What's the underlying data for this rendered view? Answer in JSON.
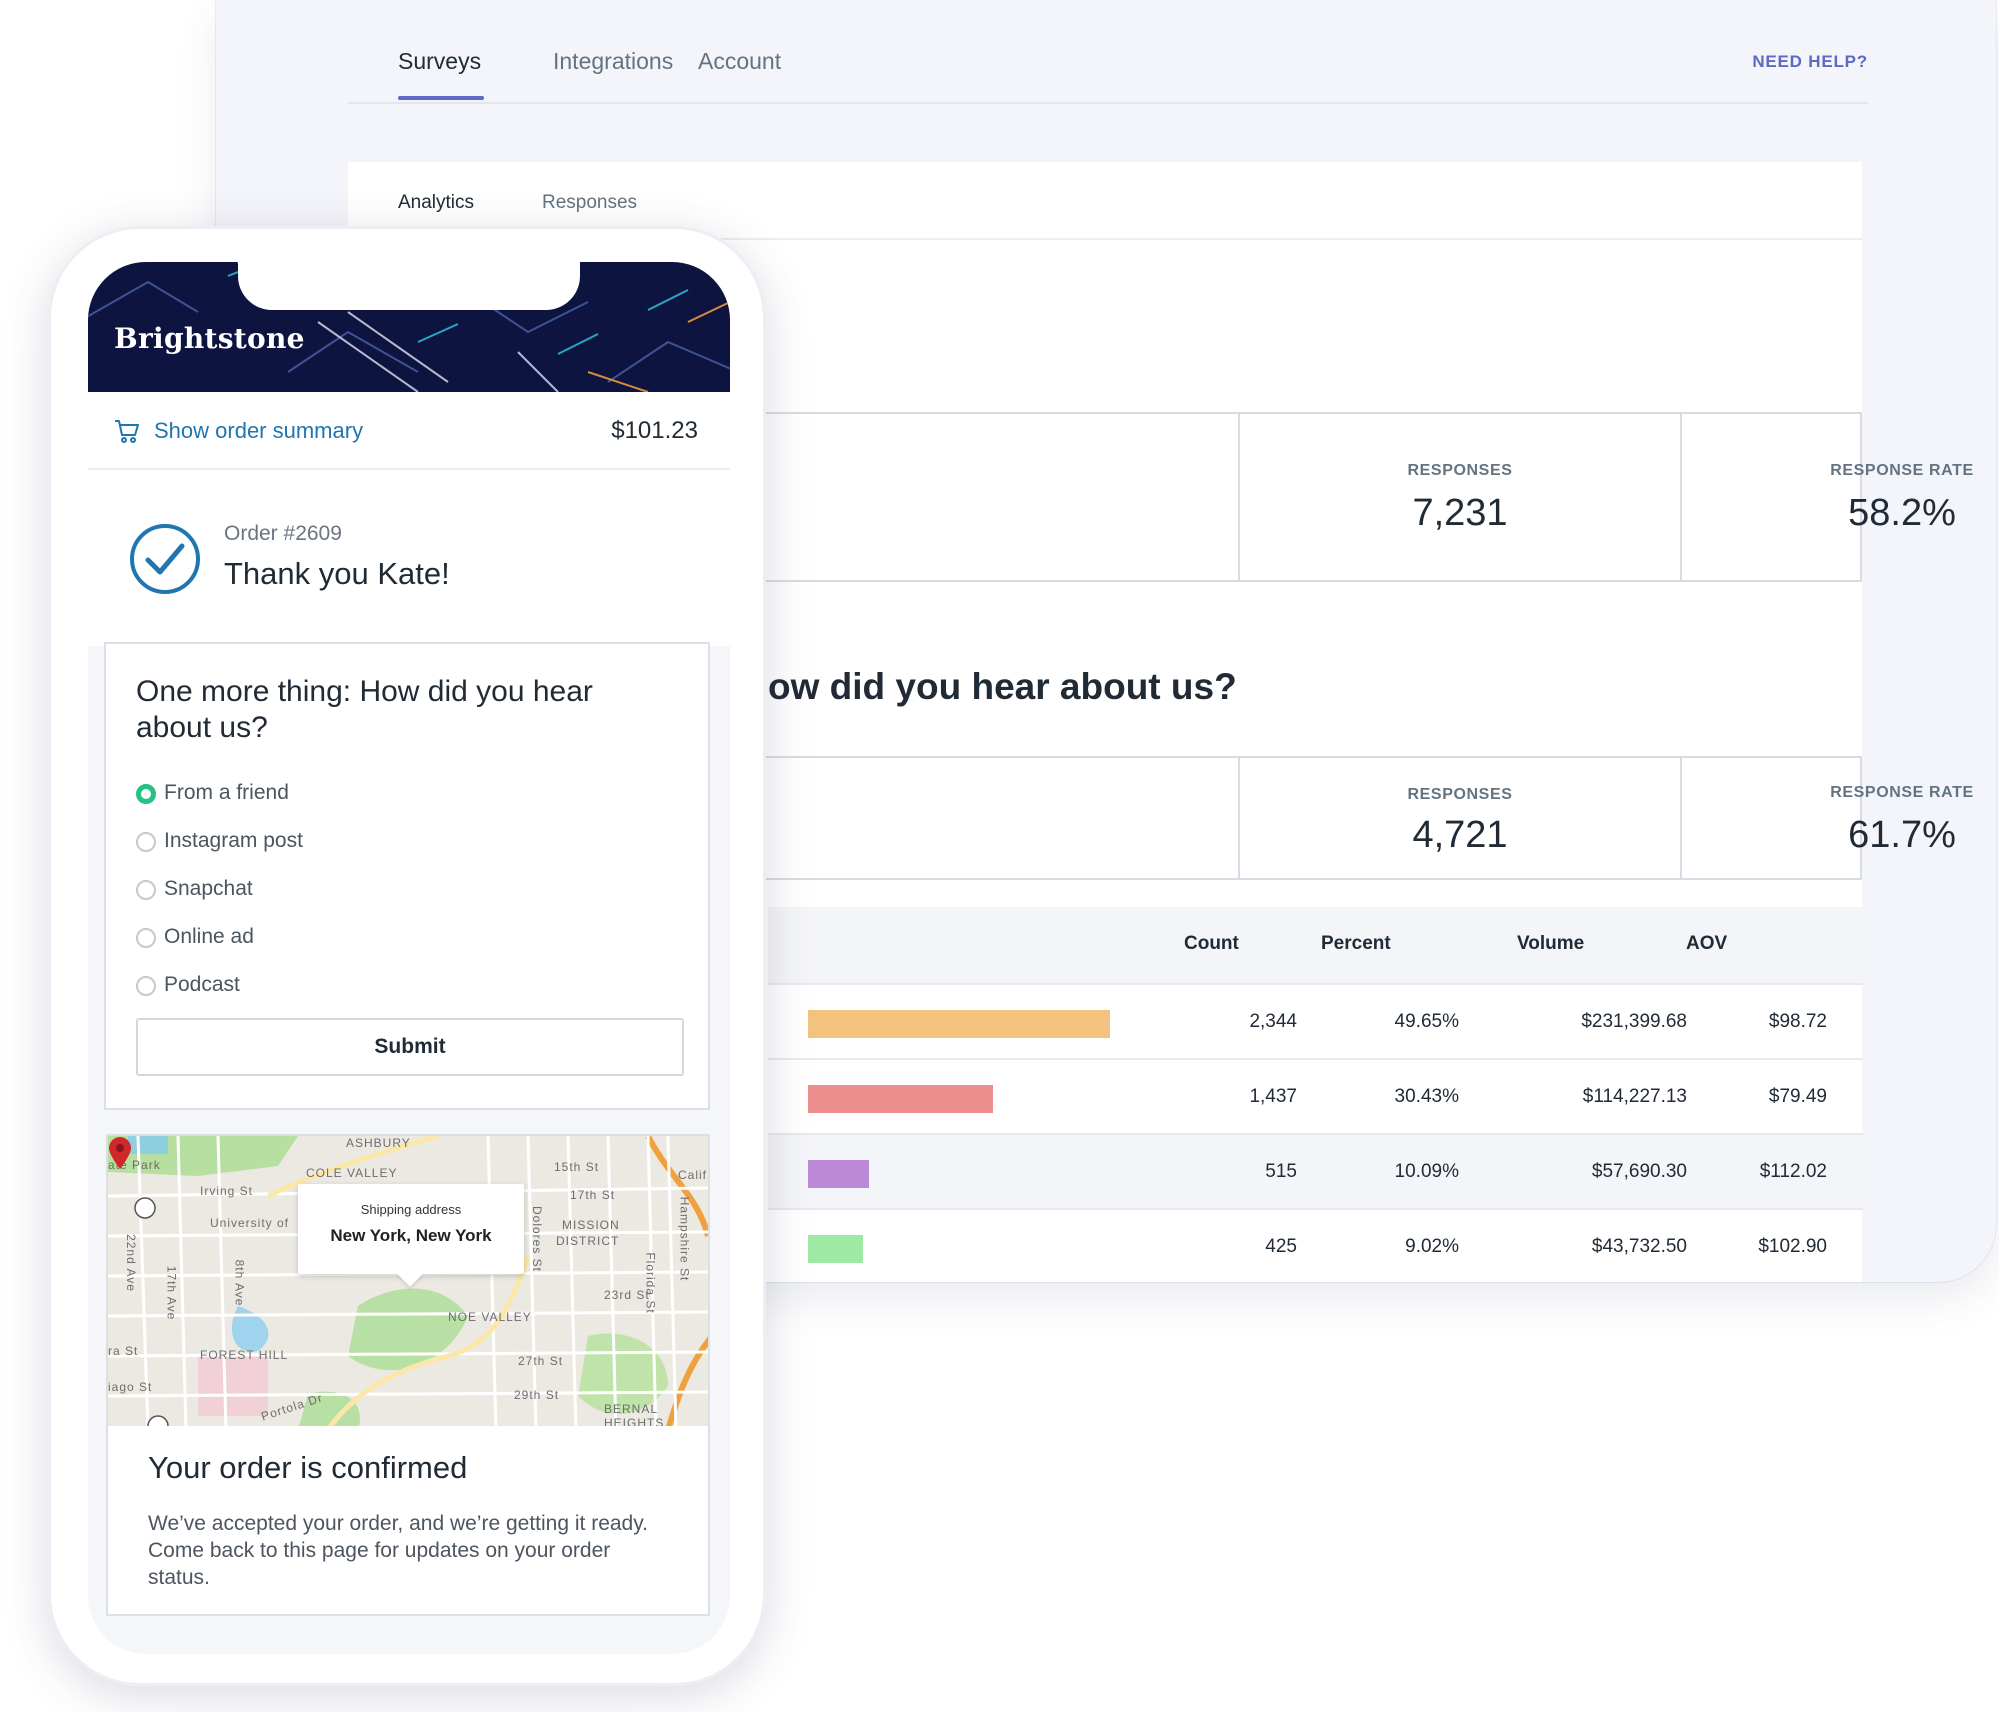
{
  "dashboard": {
    "nav_tabs": [
      {
        "label": "Surveys",
        "active": true
      },
      {
        "label": "Integrations",
        "active": false
      },
      {
        "label": "Account",
        "active": false
      }
    ],
    "help_label": "NEED HELP?",
    "sub_tabs": [
      {
        "label": "Analytics",
        "active": true
      },
      {
        "label": "Responses",
        "active": false
      }
    ],
    "summary_stats": [
      {
        "label": "RESPONSES",
        "value": "7,231"
      },
      {
        "label": "RESPONSE RATE",
        "value": "58.2%"
      }
    ],
    "question_heading": "ow did you hear about us?",
    "question_stats": [
      {
        "label": "RESPONSES",
        "value": "4,721"
      },
      {
        "label": "RESPONSE RATE",
        "value": "61.7%"
      }
    ],
    "table": {
      "headers": {
        "count": "Count",
        "percent": "Percent",
        "volume": "Volume",
        "aov": "AOV"
      },
      "rows": [
        {
          "count": "2,344",
          "percent": "49.65%",
          "volume": "$231,399.68",
          "aov": "$98.72",
          "bar_share": 49.65,
          "bar_color": "#f4c27f"
        },
        {
          "count": "1,437",
          "percent": "30.43%",
          "volume": "$114,227.13",
          "aov": "$79.49",
          "bar_share": 30.43,
          "bar_color": "#ec8e8e"
        },
        {
          "count": "515",
          "percent": "10.09%",
          "volume": "$57,690.30",
          "aov": "$112.02",
          "bar_share": 10.09,
          "bar_color": "#bb8ad6"
        },
        {
          "count": "425",
          "percent": "9.02%",
          "volume": "$43,732.50",
          "aov": "$102.90",
          "bar_share": 9.02,
          "bar_color": "#9ee9a3"
        }
      ]
    },
    "accent_color": "#5c6ac4"
  },
  "phone": {
    "brand": "Brightstone",
    "order_summary_label": "Show order summary",
    "order_total": "$101.23",
    "order_number": "Order #2609",
    "thanks_title": "Thank you Kate!",
    "survey": {
      "question": "One more thing: How did you hear about us?",
      "options": [
        {
          "label": "From a friend",
          "selected": true
        },
        {
          "label": "Instagram post",
          "selected": false
        },
        {
          "label": "Snapchat",
          "selected": false
        },
        {
          "label": "Online ad",
          "selected": false
        },
        {
          "label": "Podcast",
          "selected": false
        }
      ],
      "submit_label": "Submit"
    },
    "map": {
      "tooltip_title": "Shipping address",
      "tooltip_address": "New York, New York",
      "labels": [
        "ASHBURY",
        "ate Park",
        "COLE VALLEY",
        "15th St",
        "Calif",
        "Irving St",
        "17th St",
        "University of",
        "MISSION",
        "DISTRICT",
        "22nd Ave",
        "17th Ave",
        "8th Ave",
        "Dolores St",
        "Hampshire St",
        "Florida St",
        "23rd St",
        "NOE VALLEY",
        "ra St",
        "FOREST HILL",
        "27th St",
        "iago St",
        "29th St",
        "Portola Dr",
        "BERNAL",
        "HEIGHTS"
      ]
    },
    "confirmation": {
      "title": "Your order is confirmed",
      "body": "We’ve accepted your order, and we’re getting it ready. Come back to this page for updates on your order status."
    }
  }
}
